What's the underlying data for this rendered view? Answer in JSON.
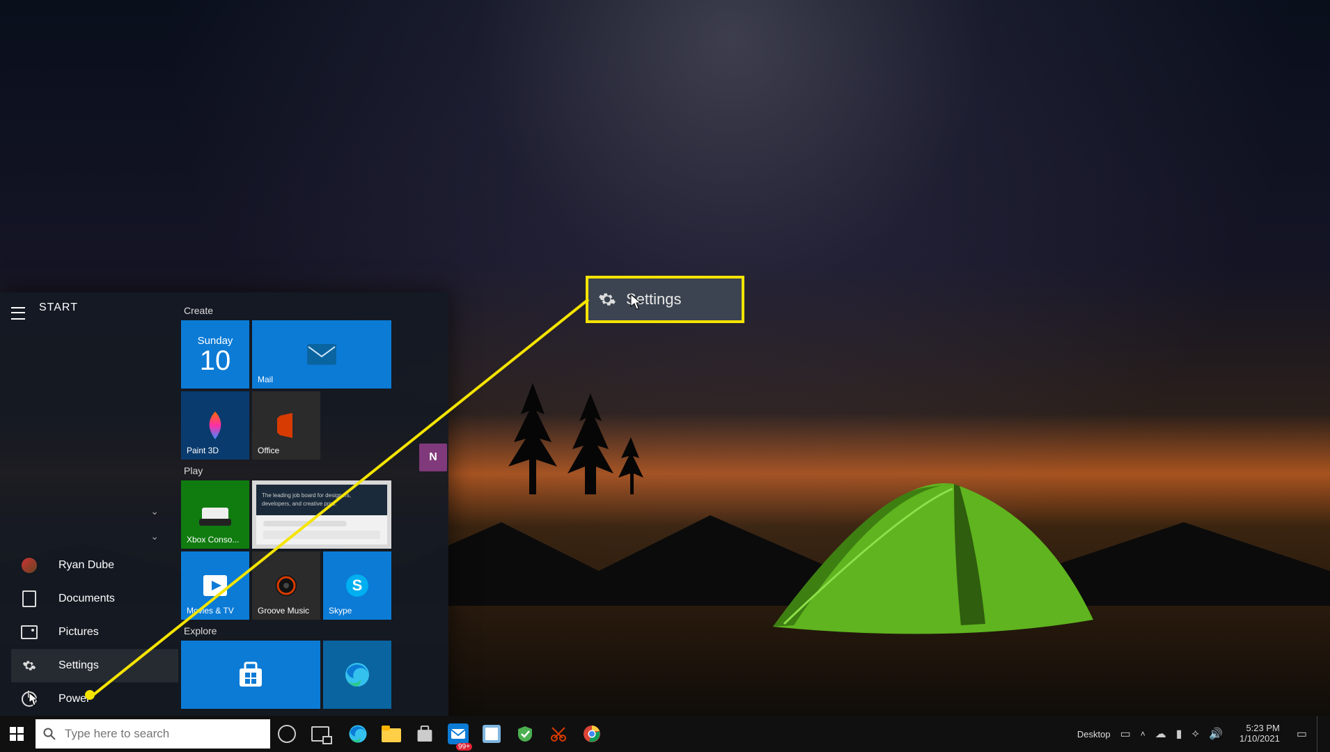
{
  "start": {
    "title": "START",
    "user_name": "Ryan Dube",
    "items": {
      "documents": "Documents",
      "pictures": "Pictures",
      "settings": "Settings",
      "power": "Power"
    },
    "groups": {
      "create": "Create",
      "play": "Play",
      "explore": "Explore"
    },
    "tiles": {
      "calendar_day": "Sunday",
      "calendar_num": "10",
      "mail": "Mail",
      "paint3d": "Paint 3D",
      "office": "Office",
      "xbox": "Xbox Conso...",
      "movies": "Movies & TV",
      "groove": "Groove Music",
      "skype": "Skype"
    }
  },
  "callout": {
    "label": "Settings"
  },
  "taskbar": {
    "search_placeholder": "Type here to search",
    "systray": {
      "desktop_label": "Desktop",
      "badge": "99+",
      "time": "5:23 PM",
      "date": "1/10/2021"
    }
  },
  "colors": {
    "accent_yellow": "#f5e400",
    "tile_blue": "#0b7bd6"
  }
}
